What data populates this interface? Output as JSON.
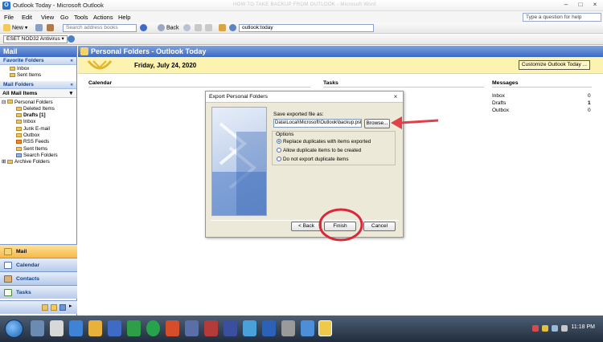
{
  "window": {
    "title": "Outlook Today - Microsoft Outlook",
    "ghost_text": "HOW TO TAKE BACKUP FROM OUTLOOK - Microsoft Word",
    "controls": [
      "–",
      "□",
      "×"
    ]
  },
  "menu": {
    "items": [
      "File",
      "Edit",
      "View",
      "Go",
      "Tools",
      "Actions",
      "Help"
    ],
    "help_placeholder": "Type a question for help"
  },
  "toolbar": {
    "new_label": "New",
    "search_placeholder": "Search address books",
    "back_label": "Back",
    "address_value": "outlook:today"
  },
  "toolbar2": {
    "eset_label": "ESET NOD32 Antivirus"
  },
  "nav": {
    "header": "Mail",
    "favorites_title": "Favorite Folders",
    "favorites": [
      "Inbox",
      "Sent Items"
    ],
    "mail_folders_title": "Mail Folders",
    "all_mail_label": "All Mail Items",
    "root_folder": "Personal Folders",
    "folders": [
      {
        "name": "Deleted Items",
        "bold": false
      },
      {
        "name": "Drafts [1]",
        "bold": true
      },
      {
        "name": "Inbox",
        "bold": false
      },
      {
        "name": "Junk E-mail",
        "bold": false
      },
      {
        "name": "Outbox",
        "bold": false
      },
      {
        "name": "RSS Feeds",
        "bold": false
      },
      {
        "name": "Sent Items",
        "bold": false
      },
      {
        "name": "Search Folders",
        "bold": false
      }
    ],
    "archive_folder": "Archive Folders",
    "buttons": [
      "Mail",
      "Calendar",
      "Contacts",
      "Tasks"
    ],
    "active_button": "Mail"
  },
  "content": {
    "header": "Personal Folders - Outlook Today",
    "date": "Friday, July 24, 2020",
    "customize_label": "Customize Outlook Today ...",
    "calendar_title": "Calendar",
    "tasks_title": "Tasks",
    "messages_title": "Messages",
    "messages": [
      {
        "name": "Inbox",
        "count": "0"
      },
      {
        "name": "Drafts",
        "count": "1"
      },
      {
        "name": "Outbox",
        "count": "0"
      }
    ]
  },
  "dialog": {
    "title": "Export Personal Folders",
    "save_label": "Save exported file as:",
    "path_value": "Data\\Local\\Microsoft\\Outlook\\backup.pst",
    "browse_label": "Browse...",
    "options_title": "Options",
    "options": [
      {
        "label": "Replace duplicates with items exported",
        "checked": true
      },
      {
        "label": "Allow duplicate items to be created",
        "checked": false
      },
      {
        "label": "Do not export duplicate items",
        "checked": false
      }
    ],
    "back_label": "< Back",
    "finish_label": "Finish",
    "cancel_label": "Cancel"
  },
  "annotations": {
    "arrow_color": "#e0404a",
    "circle_color": "#d9283a"
  },
  "taskbar": {
    "clock": "11:18 PM"
  }
}
